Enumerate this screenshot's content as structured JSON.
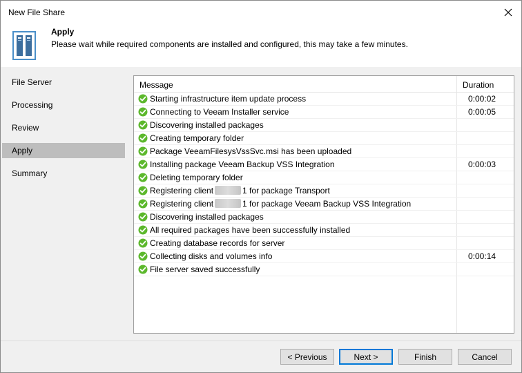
{
  "window": {
    "title": "New File Share"
  },
  "header": {
    "title": "Apply",
    "description": "Please wait while required components are installed and configured, this may take a few minutes."
  },
  "sidebar": {
    "items": [
      {
        "label": "File Server",
        "active": false
      },
      {
        "label": "Processing",
        "active": false
      },
      {
        "label": "Review",
        "active": false
      },
      {
        "label": "Apply",
        "active": true
      },
      {
        "label": "Summary",
        "active": false
      }
    ]
  },
  "grid": {
    "columns": {
      "message": "Message",
      "duration": "Duration"
    },
    "rows": [
      {
        "message": "Starting infrastructure item update process",
        "duration": "0:00:02"
      },
      {
        "message": "Connecting to Veeam Installer service",
        "duration": "0:00:05"
      },
      {
        "message": "Discovering installed packages",
        "duration": ""
      },
      {
        "message": "Creating temporary folder",
        "duration": ""
      },
      {
        "message": "Package VeeamFilesysVssSvc.msi has been uploaded",
        "duration": ""
      },
      {
        "message": "Installing package Veeam Backup VSS Integration",
        "duration": "0:00:03"
      },
      {
        "message": "Deleting temporary folder",
        "duration": ""
      },
      {
        "message_pre": "Registering client",
        "message_post": "1 for package Transport",
        "duration": ""
      },
      {
        "message_pre": "Registering client",
        "message_post": "1 for package Veeam Backup VSS Integration",
        "duration": ""
      },
      {
        "message": "Discovering installed packages",
        "duration": ""
      },
      {
        "message": "All required packages have been successfully installed",
        "duration": ""
      },
      {
        "message": "Creating database records for server",
        "duration": ""
      },
      {
        "message": "Collecting disks and volumes info",
        "duration": "0:00:14"
      },
      {
        "message": "File server saved successfully",
        "duration": ""
      }
    ],
    "status_icon": "success-check-icon",
    "status_color": "#5cb82c"
  },
  "footer": {
    "previous_label": "< Previous",
    "next_label": "Next >",
    "finish_label": "Finish",
    "cancel_label": "Cancel"
  },
  "colors": {
    "accent": "#0078d7",
    "sidebar_active": "#bdbdbd",
    "panel_bg": "#f0f0f0"
  }
}
